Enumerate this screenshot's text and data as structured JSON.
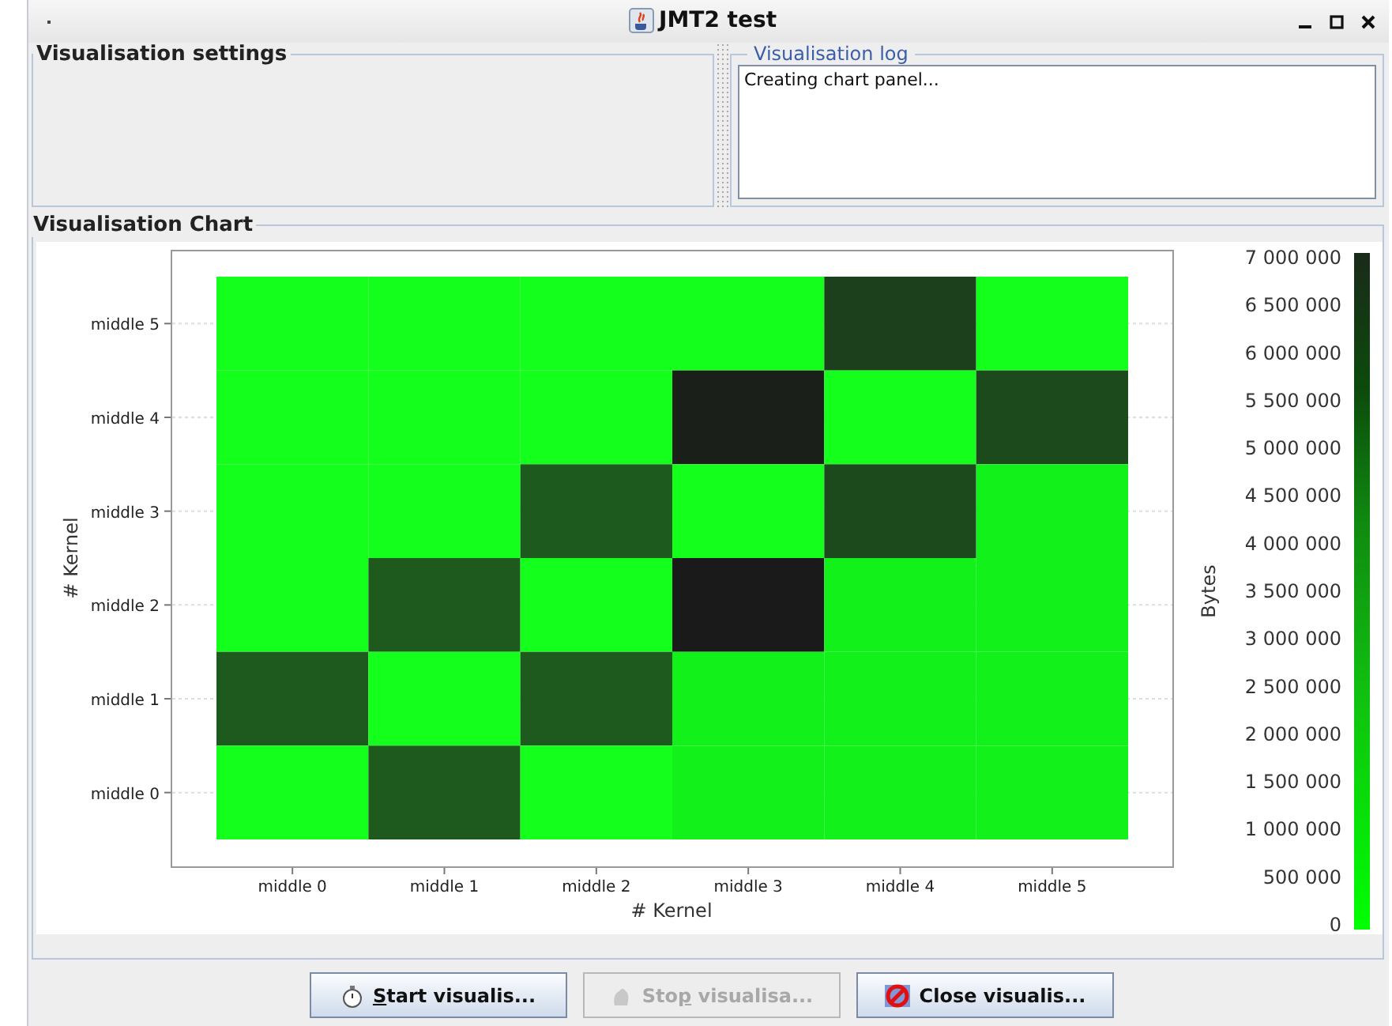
{
  "window": {
    "title": "JMT2 test"
  },
  "settings_panel": {
    "title": "Visualisation settings"
  },
  "log_panel": {
    "title": "Visualisation log",
    "lines": [
      "Creating chart panel..."
    ]
  },
  "chart_panel": {
    "title": "Visualisation Chart",
    "heatmap": {
      "xlabel": "# Kernel",
      "ylabel": "# Kernel",
      "x_categories": [
        "middle 0",
        "middle 1",
        "middle 2",
        "middle 3",
        "middle 4",
        "middle 5"
      ],
      "y_categories": [
        "middle 5",
        "middle 4",
        "middle 3",
        "middle 2",
        "middle 1",
        "middle 0"
      ],
      "rows": [
        {
          "cells": [
            {
              "color": "#14ff1c"
            },
            {
              "color": "#14ff1c"
            },
            {
              "color": "#14ff1c"
            },
            {
              "color": "#14ff1c"
            },
            {
              "color": "#1c3f1c"
            },
            {
              "color": "#14ff1c"
            }
          ]
        },
        {
          "cells": [
            {
              "color": "#14ff1c"
            },
            {
              "color": "#14ff1c"
            },
            {
              "color": "#14ff1c"
            },
            {
              "color": "#1a1f1a"
            },
            {
              "color": "#14ff1c"
            },
            {
              "color": "#1c4a1c"
            }
          ]
        },
        {
          "cells": [
            {
              "color": "#14ff1c"
            },
            {
              "color": "#14ff1c"
            },
            {
              "color": "#1d5a1d"
            },
            {
              "color": "#14ff1c"
            },
            {
              "color": "#1d4a1d"
            },
            {
              "color": "#12f21a"
            }
          ]
        },
        {
          "cells": [
            {
              "color": "#14ff1c"
            },
            {
              "color": "#1e5a1e"
            },
            {
              "color": "#14ff1c"
            },
            {
              "color": "#1a1a1a"
            },
            {
              "color": "#12f21a"
            },
            {
              "color": "#12f21a"
            }
          ]
        },
        {
          "cells": [
            {
              "color": "#1e5a1e"
            },
            {
              "color": "#14ff1c"
            },
            {
              "color": "#1e5a1e"
            },
            {
              "color": "#12f21a"
            },
            {
              "color": "#12f21a"
            },
            {
              "color": "#12f21a"
            }
          ]
        },
        {
          "cells": [
            {
              "color": "#14ff1c"
            },
            {
              "color": "#1e5a1e"
            },
            {
              "color": "#14ff1c"
            },
            {
              "color": "#12f21a"
            },
            {
              "color": "#12f21a"
            },
            {
              "color": "#12f21a"
            }
          ]
        }
      ]
    },
    "colorbar": {
      "label": "Bytes",
      "ticks": [
        "7 000 000",
        "6 500 000",
        "6 000 000",
        "5 500 000",
        "5 000 000",
        "4 500 000",
        "4 000 000",
        "3 500 000",
        "3 000 000",
        "2 500 000",
        "2 000 000",
        "1 500 000",
        "1 000 000",
        "500 000",
        "0"
      ]
    }
  },
  "buttons": [
    {
      "mnemonic": "S",
      "label_after": "tart visualis...",
      "disabled": false,
      "kind": "stopwatch"
    },
    {
      "label_before": "Sto",
      "mnemonic": "p",
      "label_after": " visualisa...",
      "disabled": true,
      "kind": "stop"
    },
    {
      "label_before": "Close visualis...",
      "disabled": false,
      "kind": "close"
    }
  ]
}
